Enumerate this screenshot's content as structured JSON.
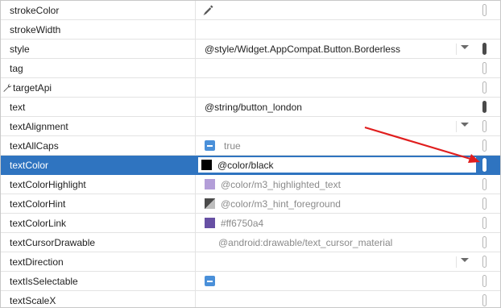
{
  "rows": [
    {
      "name": "strokeColor",
      "value": "",
      "kind": "eyedropper",
      "indicator": "empty"
    },
    {
      "name": "strokeWidth",
      "value": "",
      "kind": "empty",
      "indicator": "none"
    },
    {
      "name": "style",
      "value": "@style/Widget.AppCompat.Button.Borderless",
      "kind": "dropdown",
      "indicator": "filled"
    },
    {
      "name": "tag",
      "value": "",
      "kind": "empty",
      "indicator": "empty"
    },
    {
      "name": "targetApi",
      "value": "",
      "kind": "wrench",
      "indicator": "empty"
    },
    {
      "name": "text",
      "value": "@string/button_london",
      "kind": "text",
      "indicator": "filled"
    },
    {
      "name": "textAlignment",
      "value": "",
      "kind": "dropdown",
      "indicator": "empty"
    },
    {
      "name": "textAllCaps",
      "value": "true",
      "kind": "checkbox",
      "indicator": "empty"
    },
    {
      "name": "textColor",
      "value": "@color/black",
      "kind": "swatch-black",
      "indicator": "selected"
    },
    {
      "name": "textColorHighlight",
      "value": "@color/m3_highlighted_text",
      "kind": "swatch-lilac",
      "indicator": "empty"
    },
    {
      "name": "textColorHint",
      "value": "@color/m3_hint_foreground",
      "kind": "swatch-grad",
      "indicator": "empty"
    },
    {
      "name": "textColorLink",
      "value": "#ff6750a4",
      "kind": "swatch-purple",
      "indicator": "empty"
    },
    {
      "name": "textCursorDrawable",
      "value": "@android:drawable/text_cursor_material",
      "kind": "muted",
      "indicator": "empty"
    },
    {
      "name": "textDirection",
      "value": "",
      "kind": "dropdown",
      "indicator": "empty"
    },
    {
      "name": "textIsSelectable",
      "value": "",
      "kind": "checkbox",
      "indicator": "empty"
    },
    {
      "name": "textScaleX",
      "value": "",
      "kind": "empty",
      "indicator": "empty"
    }
  ],
  "selected_row": "textColor",
  "colors": {
    "selection": "#2f74c0",
    "annotation_arrow": "#e01e1e",
    "swatch_black": "#000000",
    "swatch_highlight": "#b39ed8",
    "swatch_link": "#6750a4"
  },
  "icons": {
    "eyedropper": "eyedropper-icon",
    "wrench": "wrench-icon",
    "checkbox": "checkbox-indeterminate-icon",
    "dropdown": "chevron-down-icon"
  }
}
